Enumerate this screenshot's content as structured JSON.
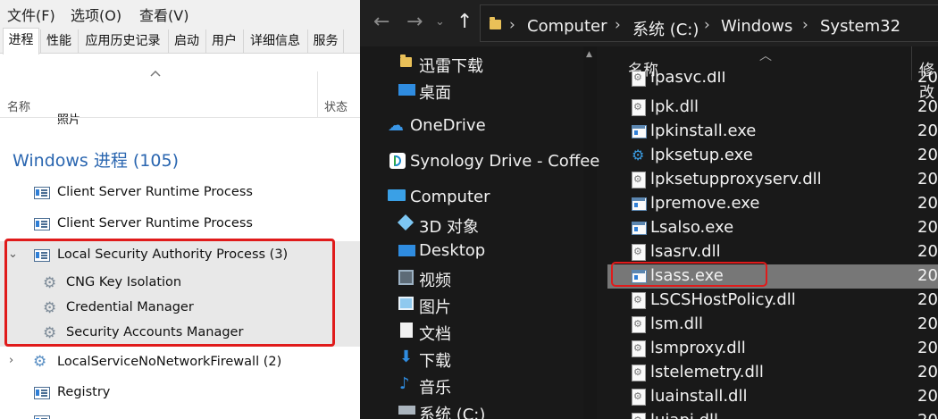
{
  "task_manager": {
    "menu": [
      "文件(F)",
      "选项(O)",
      "查看(V)"
    ],
    "tabs": [
      "进程",
      "性能",
      "应用历史记录",
      "启动",
      "用户",
      "详细信息",
      "服务"
    ],
    "columns": {
      "name": "名称",
      "status": "状态"
    },
    "partial_row": "照片",
    "group_title": "Windows 进程 (105)",
    "rows": [
      "Client Server Runtime Process",
      "Client Server Runtime Process",
      "Local Security Authority Process (3)",
      "CNG Key Isolation",
      "Credential Manager",
      "Security Accounts Manager",
      "LocalServiceNoNetworkFirewall (2)",
      "Registry"
    ]
  },
  "explorer": {
    "breadcrumb": [
      "Computer",
      "系统 (C:)",
      "Windows",
      "System32"
    ],
    "nav_items": [
      "迅雷下载",
      "桌面",
      "OneDrive",
      "Synology Drive - Coffee",
      "Computer",
      "3D 对象",
      "Desktop",
      "视频",
      "图片",
      "文档",
      "下载",
      "音乐",
      "系统 (C:)"
    ],
    "columns": {
      "name": "名称",
      "modified": "修改"
    },
    "files": [
      {
        "name": "lpasvc.dll",
        "mod": "20",
        "type": "dll"
      },
      {
        "name": "lpk.dll",
        "mod": "20",
        "type": "dll"
      },
      {
        "name": "lpkinstall.exe",
        "mod": "20",
        "type": "exe"
      },
      {
        "name": "lpksetup.exe",
        "mod": "20",
        "type": "setup"
      },
      {
        "name": "lpksetupproxyserv.dll",
        "mod": "20",
        "type": "dll"
      },
      {
        "name": "lpremove.exe",
        "mod": "20",
        "type": "exe"
      },
      {
        "name": "Lsalso.exe",
        "mod": "20",
        "type": "exe"
      },
      {
        "name": "lsasrv.dll",
        "mod": "20",
        "type": "dll"
      },
      {
        "name": "lsass.exe",
        "mod": "20",
        "type": "exe"
      },
      {
        "name": "LSCSHostPolicy.dll",
        "mod": "20",
        "type": "dll"
      },
      {
        "name": "lsm.dll",
        "mod": "20",
        "type": "dll"
      },
      {
        "name": "lsmproxy.dll",
        "mod": "20",
        "type": "dll"
      },
      {
        "name": "lstelemetry.dll",
        "mod": "20",
        "type": "dll"
      },
      {
        "name": "luainstall.dll",
        "mod": "20",
        "type": "dll"
      },
      {
        "name": "luiapi.dll",
        "mod": "20",
        "type": "dll"
      }
    ]
  },
  "colors": {
    "highlight_box": "#e01b1b",
    "group_title": "#2a66b0",
    "folder": "#e9c058"
  }
}
